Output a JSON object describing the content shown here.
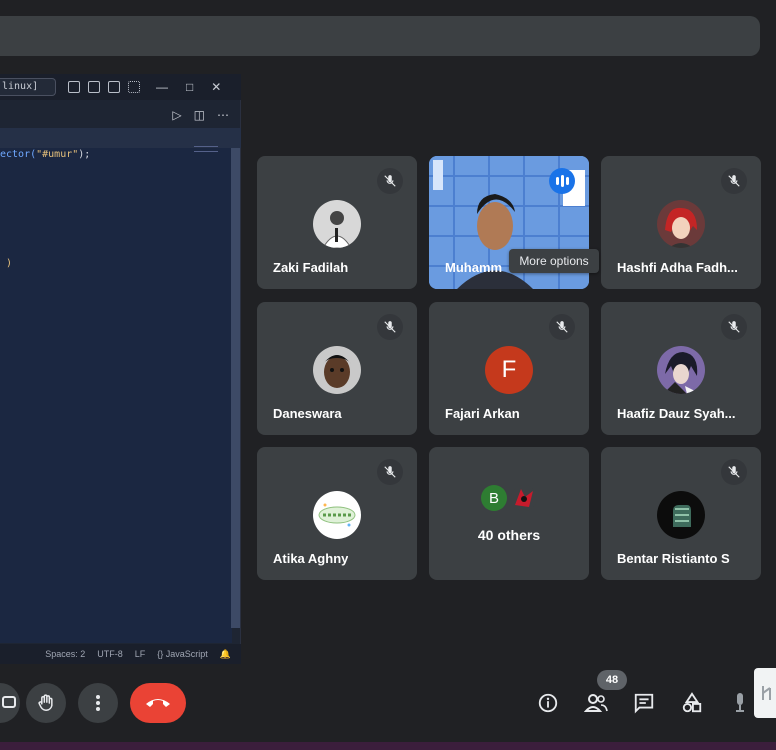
{
  "editor": {
    "tab_label": "linux]",
    "code_line_fn": "ector(",
    "code_line_str": "\"#umur\"",
    "code_line_end": ");",
    "code_brace": ")",
    "status": [
      "Spaces: 2",
      "UTF-8",
      "LF",
      "{} JavaScript"
    ]
  },
  "participants": [
    {
      "name": "Zaki Fadilah",
      "muted": true
    },
    {
      "name": "Muhamm",
      "speaking": true
    },
    {
      "name": "Hashfi Adha Fadh...",
      "muted": true
    },
    {
      "name": "Daneswara",
      "muted": true
    },
    {
      "name": "Fajari Arkan",
      "muted": true,
      "initial": "F",
      "color": "#c5391c"
    },
    {
      "name": "Haafiz Dauz Syah...",
      "muted": true
    },
    {
      "name": "Atika Aghny",
      "muted": true
    },
    {
      "name": "40 others",
      "initial": "B",
      "color": "#2e7d32"
    },
    {
      "name": "Bentar Ristianto S",
      "muted": true
    }
  ],
  "tooltip": "More options",
  "people_count": "48",
  "colors": {
    "background": "#202124",
    "tile": "#3c4043",
    "accent": "#1a73e8",
    "hangup": "#ea4335"
  },
  "icons": [
    "mic-off-icon",
    "raise-hand-icon",
    "more-options-icon",
    "call-end-icon",
    "info-icon",
    "people-icon",
    "chat-icon",
    "activities-icon",
    "host-controls-icon"
  ]
}
